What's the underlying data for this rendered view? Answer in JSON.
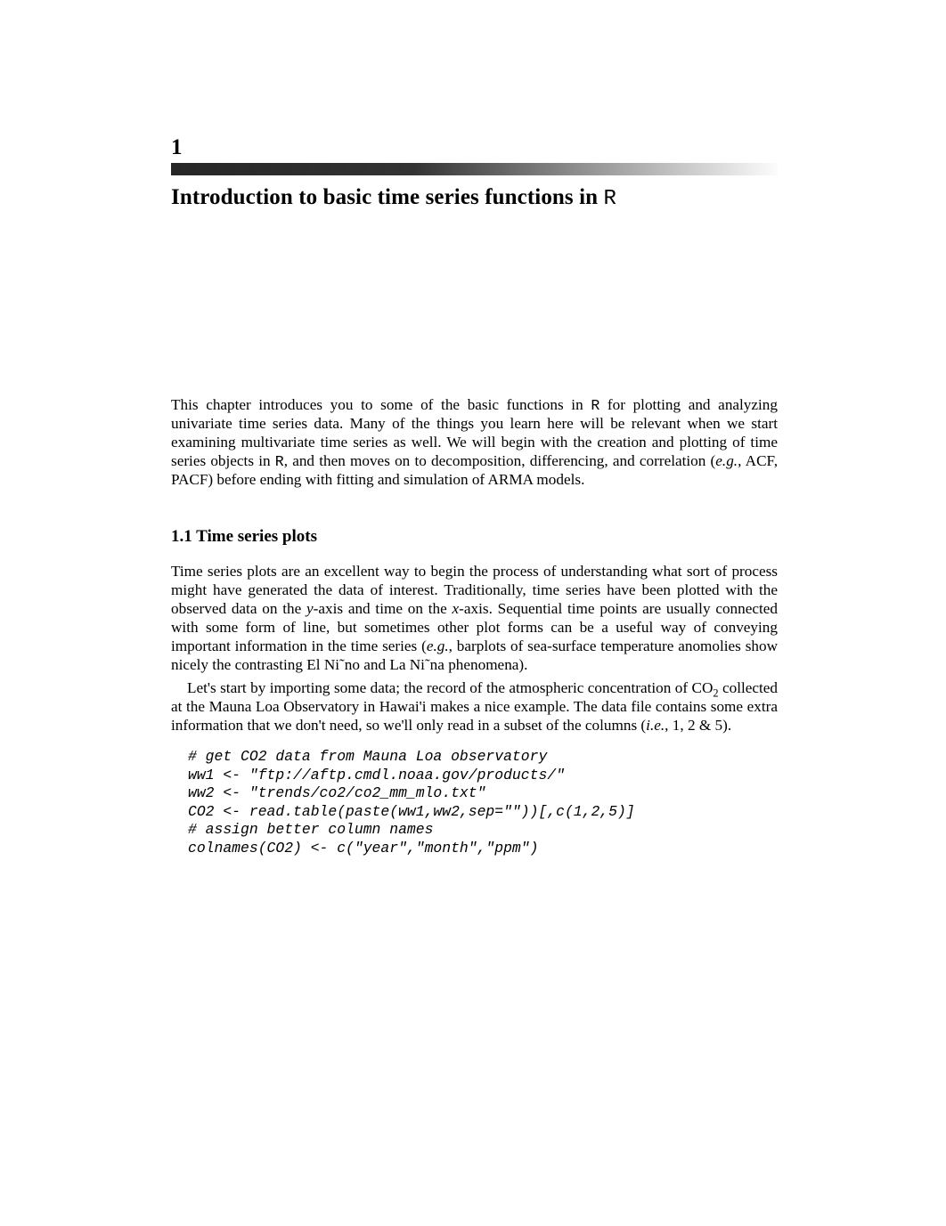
{
  "chapter": {
    "number": "1",
    "title_pre": "Introduction to basic time series functions in ",
    "title_tt": "R"
  },
  "intro": {
    "p1_a": "This chapter introduces you to some of the basic functions in ",
    "p1_tt1": "R",
    "p1_b": " for plotting and analyzing univariate time series data. Many of the things you learn here will be relevant when we start examining multivariate time series as well. We will begin with the creation and plotting of time series objects in ",
    "p1_tt2": "R",
    "p1_c": ", and then moves on to decomposition, differencing, and correlation (",
    "p1_em1": "e.g.",
    "p1_d": ", ACF, PACF) before ending with fitting and simulation of ARMA models."
  },
  "section": {
    "number": "1.1",
    "title": "Time series plots"
  },
  "body": {
    "p1_a": "Time series plots are an excellent way to begin the process of understanding what sort of process might have generated the data of interest. Traditionally, time series have been plotted with the observed data on the ",
    "p1_em1": "y",
    "p1_b": "-axis and time on the ",
    "p1_em2": "x",
    "p1_c": "-axis. Sequential time points are usually connected with some form of line, but sometimes other plot forms can be a useful way of conveying important information in the time series (",
    "p1_em3": "e.g.",
    "p1_d": ", barplots of sea-surface temperature anomolies show nicely the contrasting El Ni˜no and La Ni˜na phenomena).",
    "p2_a": "Let's start by importing some data; the record of the atmospheric concentration of CO",
    "p2_sub": "2",
    "p2_b": " collected at the Mauna Loa Observatory in Hawai'i makes a nice example. The data file contains some extra information that we don't need, so we'll only read in a subset of the columns (",
    "p2_em1": "i.e.",
    "p2_c": ", 1, 2 & 5)."
  },
  "code": {
    "l1": "# get CO2 data from Mauna Loa observatory",
    "l2": "ww1 <- \"ftp://aftp.cmdl.noaa.gov/products/\"",
    "l3": "ww2 <- \"trends/co2/co2_mm_mlo.txt\"",
    "l4": "CO2 <- read.table(paste(ww1,ww2,sep=\"\"))[,c(1,2,5)]",
    "l5": "# assign better column names",
    "l6": "colnames(CO2) <- c(\"year\",\"month\",\"ppm\")"
  }
}
